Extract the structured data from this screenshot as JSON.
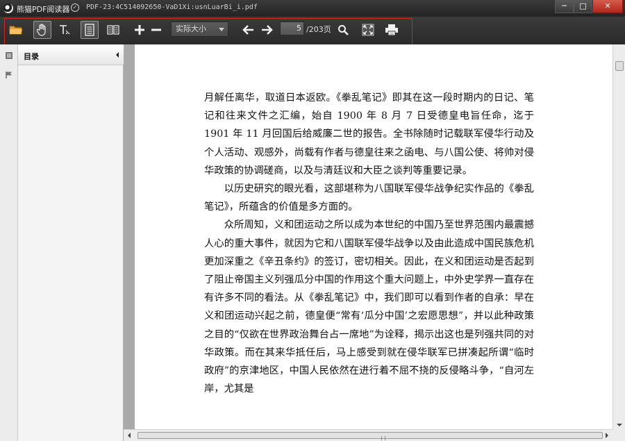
{
  "window": {
    "app_title": "熊猫PDF阅读器",
    "file_title": "PDF-23:4C514092650-VaD1Xi:usnLuarBi_i.pdf",
    "minimize_label": "─",
    "maximize_label": "□",
    "close_label": "✕"
  },
  "toolbar": {
    "zoom_value": "实际大小",
    "page_current": "5",
    "page_total_text": "/203页"
  },
  "sidebar": {
    "panel_title": "目录"
  },
  "document": {
    "paragraphs": [
      "月解任离华，取道日本返欧。《拳乱笔记》即其在这一段时期内的日记、笔记和往来文件之汇编，始自 1900 年 8 月 7 日受德皇电旨任命，迄于 1901 年 11 月回国后给威廉二世的报告。全书除随时记载联军侵华行动及个人活动、观感外，尚载有作者与德皇往来之函电、与八国公使、将帅对侵华政策的协调磋商，以及与清廷议和大臣之谈判等重要记录。",
      "以历史研究的眼光看，这部堪称为八国联军侵华战争纪实作品的《拳乱笔记》，所蕴含的价值是多方面的。",
      "众所周知，义和团运动之所以成为本世纪的中国乃至世界范围内最震撼人心的重大事件，就因为它和八国联军侵华战争以及由此造成中国民族危机更加深重之《辛丑条约》的签订，密切相关。因此，在义和团运动是否起到了阻止帝国主义列强瓜分中国的作用这个重大问题上，中外史学界一直存在有许多不同的看法。从《拳乱笔记》中，我们即可以看到作者的自承：早在义和团运动兴起之前，德皇便“常有‘瓜分中国’之宏愿思想”，并以此种政策之目的“仅欲在世界政治舞台占一席地”为诠释，揭示出这也是列强共同的对华政策。而在其来华抵任后，马上感受到就在侵华联军已拼凑起所谓“临时政府”的京津地区，中国人民依然在进行着不屈不挠的反侵略斗争，“自河左岸，尤其是"
    ]
  },
  "colors": {
    "toolbar_bg": "#2e2e2e",
    "highlight": "#e02020",
    "folder_icon": "#e8a23a"
  }
}
